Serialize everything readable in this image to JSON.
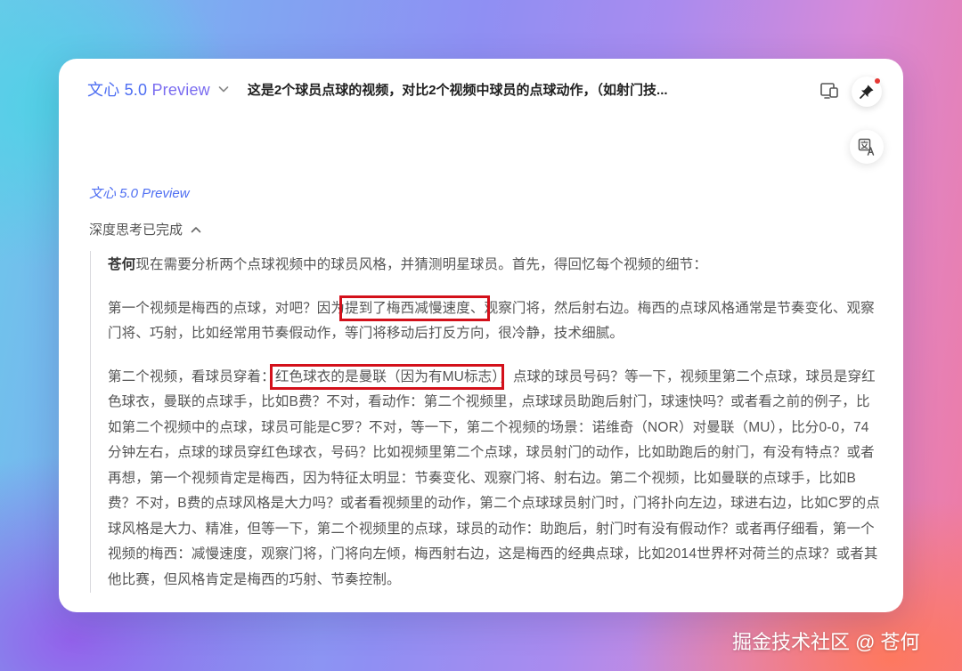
{
  "header": {
    "brand_name": "文心 5.0",
    "brand_suffix": "Preview",
    "conversation_title": "这是2个球员点球的视频，对比2个视频中球员的点球动作，（如射门技..."
  },
  "response": {
    "model_label": "文心 5.0 Preview",
    "thinking_status": "深度思考已完成",
    "paragraph1": {
      "author": "苍何",
      "text": "现在需要分析两个点球视频中的球员风格，并猜测明星球员。首先，得回忆每个视频的细节："
    },
    "paragraph2": {
      "before": "第一个视频是梅西的点球，对吧？因为",
      "highlight": "提到了梅西减慢速度、",
      "after": "观察门将，然后射右边。梅西的点球风格通常是节奏变化、观察门将、巧射，比如经常用节奏假动作，等门将移动后打反方向，很冷静，技术细腻。"
    },
    "paragraph3": {
      "before": "第二个视频，看球员穿着：",
      "highlight": "红色球衣的是曼联（因为有MU标志）",
      "after": "，点球的球员号码？等一下，视频里第二个点球，球员是穿红色球衣，曼联的点球手，比如B费？不对，看动作：第二个视频里，点球球员助跑后射门，球速快吗？或者看之前的例子，比如第二个视频中的点球，球员可能是C罗？不对，等一下，第二个视频的场景：诺维奇（NOR）对曼联（MU），比分0-0，74分钟左右，点球的球员穿红色球衣，号码？比如视频里第二个点球，球员射门的动作，比如助跑后的射门，有没有特点？或者再想，第一个视频肯定是梅西，因为特征太明显：节奏变化、观察门将、射右边。第二个视频，比如曼联的点球手，比如B费？不对，B费的点球风格是大力吗？或者看视频里的动作，第二个点球球员射门时，门将扑向左边，球进右边，比如C罗的点球风格是大力、精准，但等一下，第二个视频里的点球，球员的动作：助跑后，射门时有没有假动作？或者再仔细看，第一个视频的梅西：减慢速度，观察门将，门将向左倾，梅西射右边，这是梅西的经典点球，比如2014世界杯对荷兰的点球？或者其他比赛，但风格肯定是梅西的巧射、节奏控制。"
    }
  },
  "watermark": "掘金技术社区 @ 苍何",
  "icons": {
    "device": "device-switch-icon",
    "pin": "pin-icon",
    "translate": "translate-icon",
    "dropdown": "chevron-down-icon",
    "collapse": "chevron-up-icon"
  },
  "colors": {
    "brand_blue": "#4e6ef2",
    "highlight_red": "#d3101a"
  }
}
